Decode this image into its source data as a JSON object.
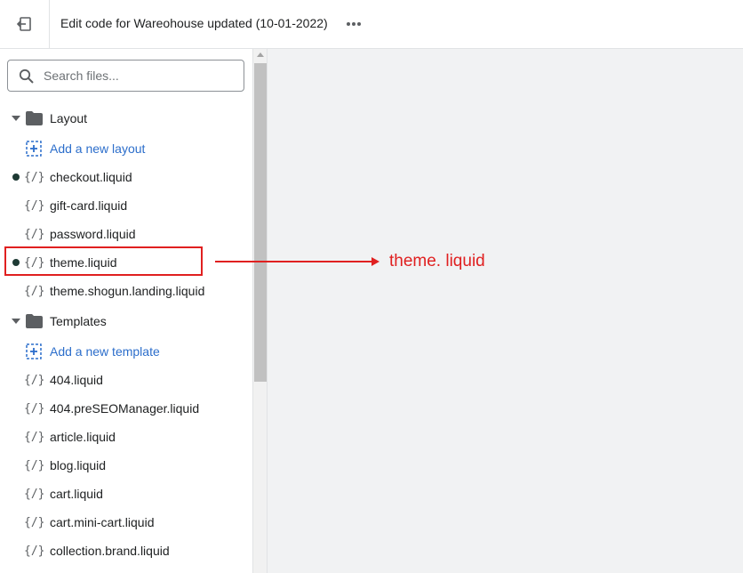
{
  "header": {
    "title": "Edit code for Wareohouse updated (10-01-2022)",
    "exit_icon": "exit-icon",
    "more_icon": "more-horizontal-icon"
  },
  "search": {
    "placeholder": "Search files..."
  },
  "sections": {
    "layout": {
      "label": "Layout",
      "add_label": "Add a new layout",
      "files": [
        "checkout.liquid",
        "gift-card.liquid",
        "password.liquid",
        "theme.liquid",
        "theme.shogun.landing.liquid"
      ]
    },
    "templates": {
      "label": "Templates",
      "add_label": "Add a new template",
      "files": [
        "404.liquid",
        "404.preSEOManager.liquid",
        "article.liquid",
        "blog.liquid",
        "cart.liquid",
        "cart.mini-cart.liquid",
        "collection.brand.liquid"
      ]
    }
  },
  "file_icon_text": "{/}",
  "annotation": {
    "text": "theme. liquid"
  },
  "colors": {
    "accent_link": "#2c6ecb",
    "annotation_red": "#e02020",
    "modified_dot": "#1e3a34",
    "editor_bg": "#f1f2f3"
  }
}
